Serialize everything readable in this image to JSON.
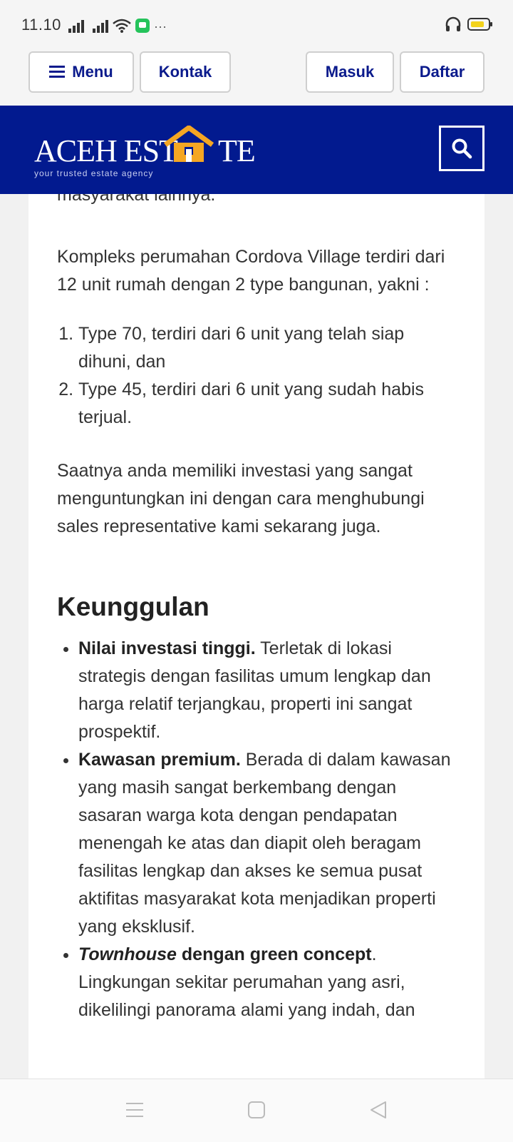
{
  "status_bar": {
    "time": "11.10",
    "more": "···"
  },
  "topbar": {
    "menu": "Menu",
    "kontak": "Kontak",
    "masuk": "Masuk",
    "daftar": "Daftar"
  },
  "header": {
    "logo_left": "ACEH EST",
    "logo_right": "TE",
    "tagline": "your trusted estate agency",
    "accent_color": "#f5a623",
    "brand_color": "#021a8f"
  },
  "content": {
    "cut_line": "masyarakat lainnya.",
    "para1": "Kompleks perumahan Cordova Village terdiri dari 12 unit rumah dengan 2 type bangunan, yakni :",
    "types": [
      "Type 70, terdiri dari 6 unit yang telah siap dihuni, dan",
      "Type 45, terdiri dari 6 unit yang sudah habis terjual."
    ],
    "para2": "Saatnya anda memiliki investasi yang sangat menguntungkan ini dengan cara menghubungi sales representative kami sekarang juga.",
    "heading": "Keunggulan",
    "features": [
      {
        "bold": "Nilai investasi tinggi.",
        "text": " Terletak di lokasi strategis dengan fasilitas umum lengkap dan harga relatif terjangkau, properti ini sangat prospektif."
      },
      {
        "bold": "Kawasan premium.",
        "text": " Berada di dalam kawasan yang masih sangat berkembang dengan sasaran warga kota dengan pendapatan menengah ke atas dan diapit oleh beragam fasilitas lengkap dan akses ke semua pusat aktifitas masyarakat kota menjadikan properti yang eksklusif."
      },
      {
        "italic": "Townhouse",
        "bold": " dengan green concept",
        "text": ". Lingkungan sekitar perumahan yang asri, dikelilingi panorama alami yang indah, dan"
      }
    ]
  },
  "icons": [
    "signal-icon",
    "wifi-icon",
    "message-icon",
    "headset-icon",
    "battery-icon",
    "menu-icon",
    "house-icon",
    "search-icon",
    "nav-menu-icon",
    "nav-home-icon",
    "nav-back-icon"
  ]
}
